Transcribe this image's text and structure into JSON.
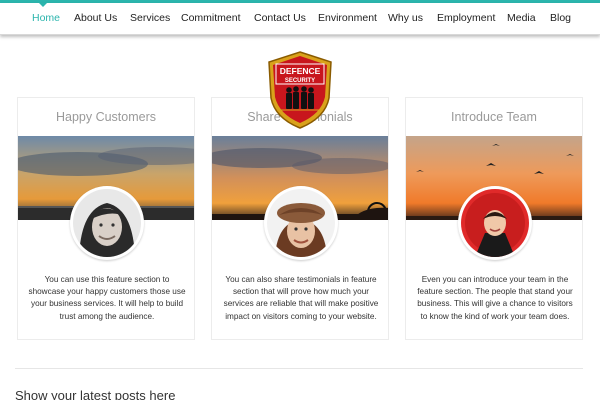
{
  "nav": {
    "items": [
      {
        "label": "Home",
        "active": true
      },
      {
        "label": "About Us"
      },
      {
        "label": "Services"
      },
      {
        "label": "Commitment"
      },
      {
        "label": "Contact Us"
      },
      {
        "label": "Environment"
      },
      {
        "label": "Why us"
      },
      {
        "label": "Employment"
      },
      {
        "label": "Media"
      },
      {
        "label": "Blog"
      }
    ]
  },
  "logo": {
    "line1": "DEFENCE",
    "line2": "SECURITY"
  },
  "features": [
    {
      "title": "Happy Customers",
      "text": "You can use this feature section to showcase your happy customers those use your business services. It will help to build trust among the audience."
    },
    {
      "title": "Share Testimonials",
      "text": "You can also share testimonials in feature section that will prove how much your services are reliable that will make positive impact on visitors coming to your website."
    },
    {
      "title": "Introduce Team",
      "text": "Even you can introduce your team in the feature section. The people that stand your business. This will give a chance to visitors to know the kind of work your team does."
    }
  ],
  "latest": {
    "heading": "Show your latest posts here"
  },
  "colors": {
    "accent": "#2bb5ad",
    "logo_red": "#c8161d",
    "logo_gold": "#d9a21b"
  }
}
